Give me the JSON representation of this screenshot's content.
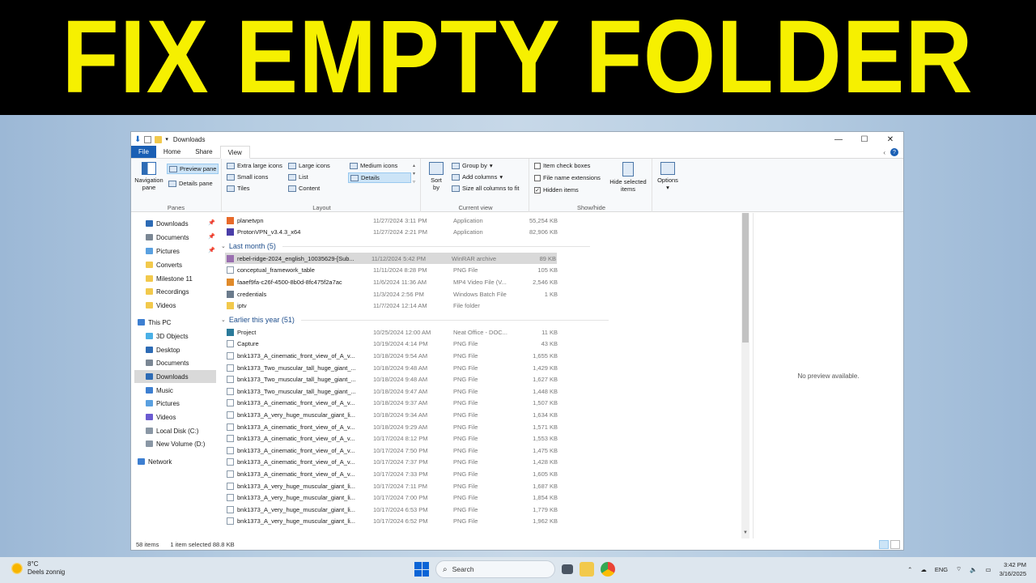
{
  "banner": {
    "text": "FIX EMPTY FOLDER"
  },
  "window": {
    "title": "Downloads",
    "tabs": [
      "File",
      "Home",
      "Share",
      "View"
    ],
    "ribbon": {
      "panes": {
        "label": "Panes",
        "navigation_pane": "Navigation pane",
        "preview_pane": "Preview pane",
        "details_pane": "Details pane"
      },
      "layout": {
        "label": "Layout",
        "items": [
          "Extra large icons",
          "Large icons",
          "Medium icons",
          "Small icons",
          "List",
          "Details",
          "Tiles",
          "Content"
        ],
        "selected": "Details"
      },
      "current_view": {
        "label": "Current view",
        "sort_by": "Sort by",
        "group_by": "Group by",
        "add_columns": "Add columns",
        "size_all": "Size all columns to fit"
      },
      "show_hide": {
        "label": "Show/hide",
        "item_check_boxes": "Item check boxes",
        "file_name_extensions": "File name extensions",
        "hidden_items": "Hidden items",
        "hide_selected": "Hide selected items"
      },
      "options": "Options"
    },
    "nav": {
      "items": [
        "Downloads",
        "Documents",
        "Pictures",
        "Converts",
        "Milestone 11",
        "Recordings",
        "Videos",
        "This PC",
        "3D Objects",
        "Desktop",
        "Documents",
        "Downloads",
        "Music",
        "Pictures",
        "Videos",
        "Local Disk (C:)",
        "New Volume (D:)",
        "Network"
      ]
    },
    "files": {
      "top": [
        {
          "name": "planetvpn",
          "date": "11/27/2024 3:11 PM",
          "type": "Application",
          "size": "55,254 KB"
        },
        {
          "name": "ProtonVPN_v3.4.3_x64",
          "date": "11/27/2024 2:21 PM",
          "type": "Application",
          "size": "82,906 KB"
        }
      ],
      "group1": "Last month (5)",
      "last_month": [
        {
          "name": "rebel-ridge-2024_english_10035629-[Sub...",
          "date": "11/12/2024 5:42 PM",
          "type": "WinRAR archive",
          "size": "89 KB"
        },
        {
          "name": "conceptual_framework_table",
          "date": "11/11/2024 8:28 PM",
          "type": "PNG File",
          "size": "105 KB"
        },
        {
          "name": "faaef9fa-c26f-4500-8b0d-8fc475f2a7ac",
          "date": "11/6/2024 11:36 AM",
          "type": "MP4 Video File (V...",
          "size": "2,546 KB"
        },
        {
          "name": "credentials",
          "date": "11/3/2024 2:56 PM",
          "type": "Windows Batch File",
          "size": "1 KB"
        },
        {
          "name": "iptv",
          "date": "11/7/2024 12:14 AM",
          "type": "File folder",
          "size": ""
        }
      ],
      "group2": "Earlier this year (51)",
      "earlier": [
        {
          "name": "Project",
          "date": "10/25/2024 12:00 AM",
          "type": "Neat Office - DOC...",
          "size": "11 KB"
        },
        {
          "name": "Capture",
          "date": "10/19/2024 4:14 PM",
          "type": "PNG File",
          "size": "43 KB"
        },
        {
          "name": "bnk1373_A_cinematic_front_view_of_A_v...",
          "date": "10/18/2024 9:54 AM",
          "type": "PNG File",
          "size": "1,655 KB"
        },
        {
          "name": "bnk1373_Two_muscular_tall_huge_giant_...",
          "date": "10/18/2024 9:48 AM",
          "type": "PNG File",
          "size": "1,429 KB"
        },
        {
          "name": "bnk1373_Two_muscular_tall_huge_giant_...",
          "date": "10/18/2024 9:48 AM",
          "type": "PNG File",
          "size": "1,627 KB"
        },
        {
          "name": "bnk1373_Two_muscular_tall_huge_giant_...",
          "date": "10/18/2024 9:47 AM",
          "type": "PNG File",
          "size": "1,448 KB"
        },
        {
          "name": "bnk1373_A_cinematic_front_view_of_A_v...",
          "date": "10/18/2024 9:37 AM",
          "type": "PNG File",
          "size": "1,507 KB"
        },
        {
          "name": "bnk1373_A_very_huge_muscular_giant_li...",
          "date": "10/18/2024 9:34 AM",
          "type": "PNG File",
          "size": "1,634 KB"
        },
        {
          "name": "bnk1373_A_cinematic_front_view_of_A_v...",
          "date": "10/18/2024 9:29 AM",
          "type": "PNG File",
          "size": "1,571 KB"
        },
        {
          "name": "bnk1373_A_cinematic_front_view_of_A_v...",
          "date": "10/17/2024 8:12 PM",
          "type": "PNG File",
          "size": "1,553 KB"
        },
        {
          "name": "bnk1373_A_cinematic_front_view_of_A_v...",
          "date": "10/17/2024 7:50 PM",
          "type": "PNG File",
          "size": "1,475 KB"
        },
        {
          "name": "bnk1373_A_cinematic_front_view_of_A_v...",
          "date": "10/17/2024 7:37 PM",
          "type": "PNG File",
          "size": "1,428 KB"
        },
        {
          "name": "bnk1373_A_cinematic_front_view_of_A_v...",
          "date": "10/17/2024 7:33 PM",
          "type": "PNG File",
          "size": "1,605 KB"
        },
        {
          "name": "bnk1373_A_very_huge_muscular_giant_li...",
          "date": "10/17/2024 7:11 PM",
          "type": "PNG File",
          "size": "1,687 KB"
        },
        {
          "name": "bnk1373_A_very_huge_muscular_giant_li...",
          "date": "10/17/2024 7:00 PM",
          "type": "PNG File",
          "size": "1,854 KB"
        },
        {
          "name": "bnk1373_A_very_huge_muscular_giant_li...",
          "date": "10/17/2024 6:53 PM",
          "type": "PNG File",
          "size": "1,779 KB"
        },
        {
          "name": "bnk1373_A_very_huge_muscular_giant_li...",
          "date": "10/17/2024 6:52 PM",
          "type": "PNG File",
          "size": "1,962 KB"
        }
      ]
    },
    "preview_text": "No preview available.",
    "status": {
      "count": "58 items",
      "selected": "1 item selected  88.8 KB"
    }
  },
  "taskbar": {
    "temp": "8°C",
    "weather": "Deels zonnig",
    "search": "Search",
    "lang": "ENG",
    "time": "3:42 PM",
    "date": "3/16/2025"
  },
  "colors": {
    "banner_bg": "#000000",
    "banner_text": "#f6f000",
    "file_tab": "#1a5fb4",
    "selection": "#d9d9d9"
  }
}
